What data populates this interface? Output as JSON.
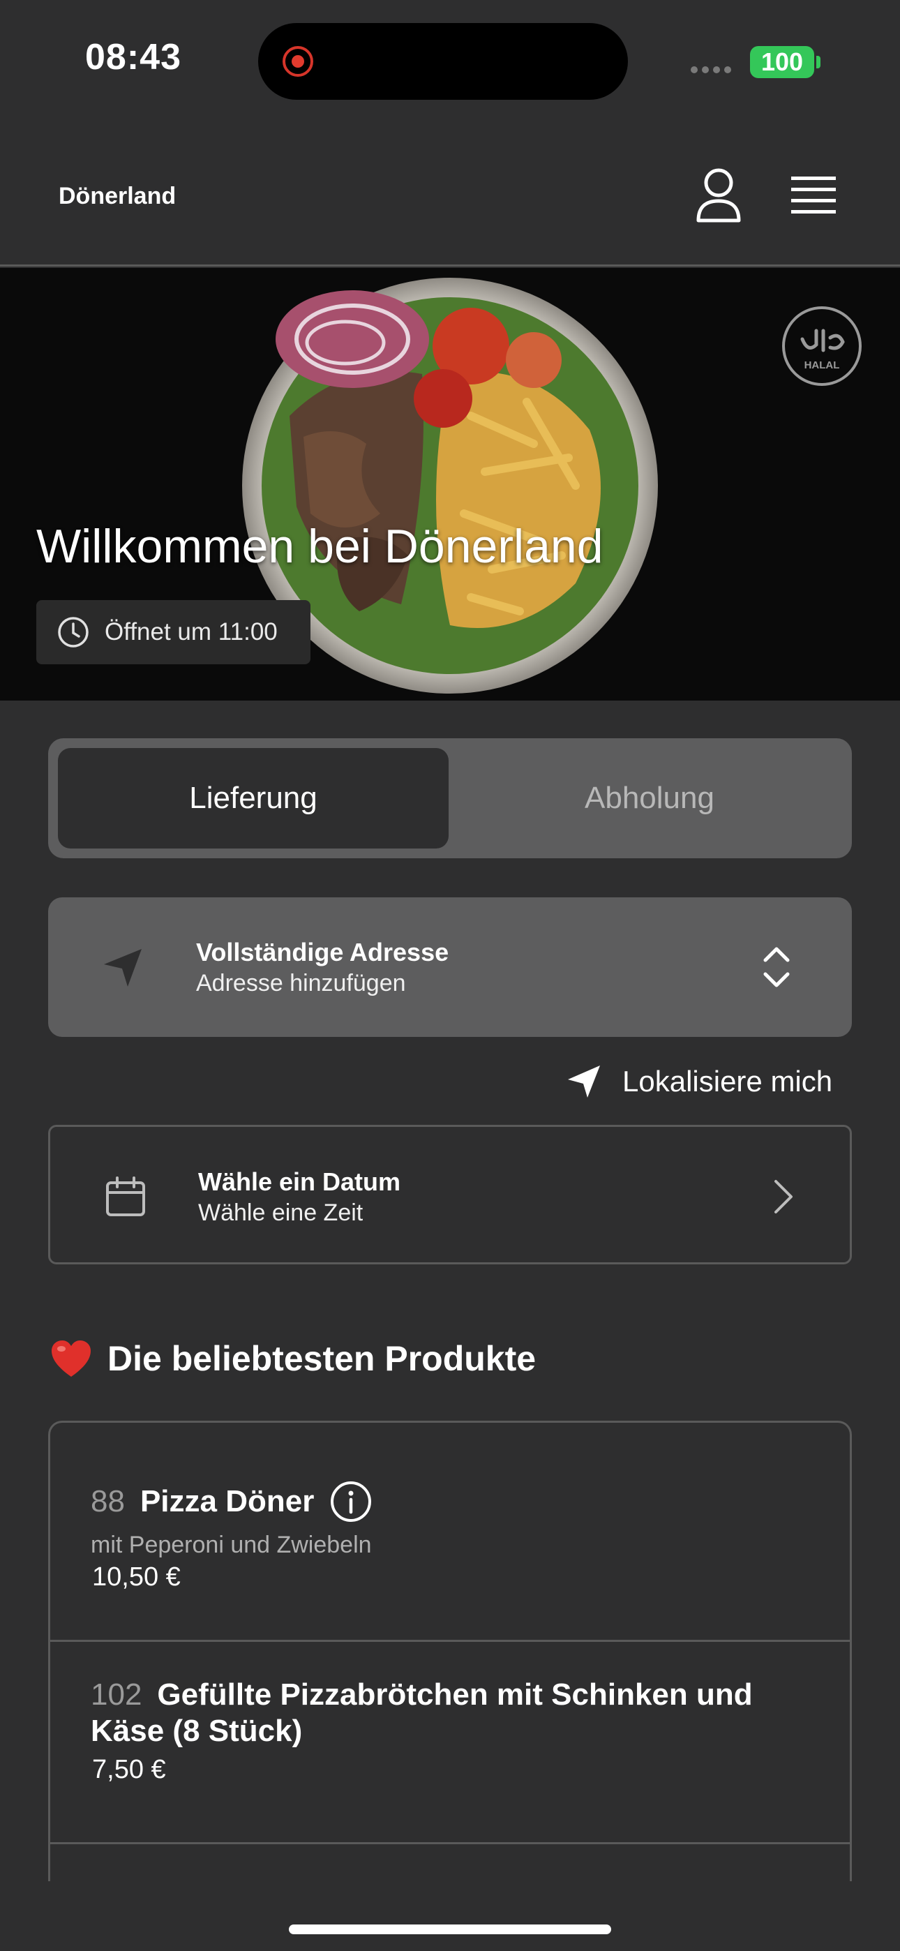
{
  "status_bar": {
    "time": "08:43",
    "battery": "100",
    "battery_color": "#34c759",
    "recording_color": "#e23b2e"
  },
  "header": {
    "brand": "Dönerland",
    "icons": [
      "profile-icon",
      "hamburger-menu-icon"
    ]
  },
  "hero": {
    "title": "Willkommen bei Dönerland",
    "opening_text": "Öffnet um 11:00",
    "badge_icon": "halal-badge-icon"
  },
  "order_mode": {
    "tabs": [
      {
        "label": "Lieferung",
        "selected": true
      },
      {
        "label": "Abholung",
        "selected": false
      }
    ]
  },
  "address": {
    "title": "Vollständige Adresse",
    "subtitle": "Adresse hinzufügen",
    "locate_label": "Lokalisiere mich"
  },
  "schedule": {
    "title": "Wähle ein Datum",
    "subtitle": "Wähle eine Zeit"
  },
  "popular": {
    "title": "Die beliebtesten Produkte",
    "icon": "heart-icon",
    "items": [
      {
        "number": "88",
        "name": "Pizza Döner",
        "description": "mit Peperoni und Zwiebeln",
        "price": "10,50 €"
      },
      {
        "number": "102",
        "name": "Gefüllte Pizzabrötchen mit Schinken und Käse (8 Stück)",
        "price": "7,50 €"
      }
    ]
  },
  "colors": {
    "background": "#2e2e2f",
    "card": "#5d5d5e",
    "accent_heart": "#e0302b"
  }
}
